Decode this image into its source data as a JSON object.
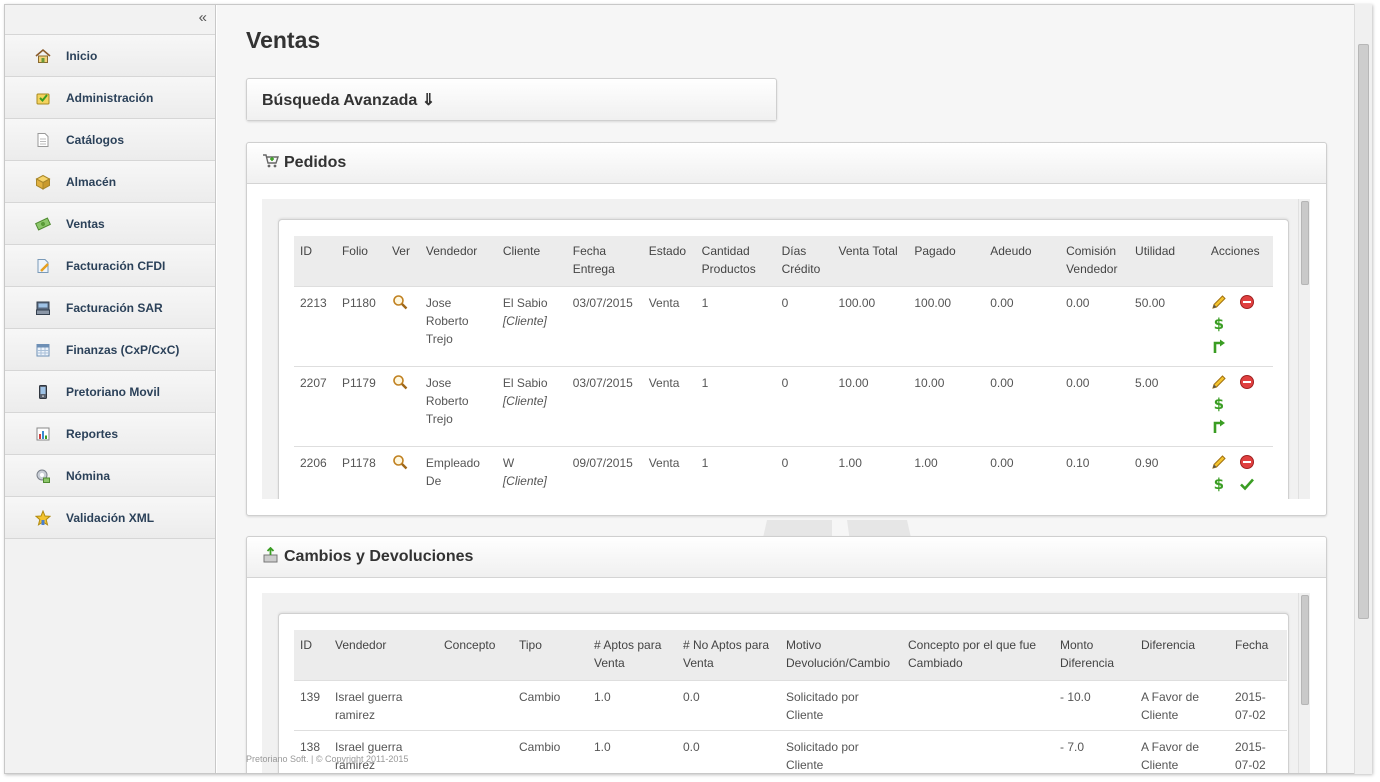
{
  "sidebar": {
    "collapse_label": "«",
    "items": [
      {
        "label": "Inicio",
        "icon": "home-icon"
      },
      {
        "label": "Administración",
        "icon": "admin-icon"
      },
      {
        "label": "Catálogos",
        "icon": "document-icon"
      },
      {
        "label": "Almacén",
        "icon": "box-icon"
      },
      {
        "label": "Ventas",
        "icon": "money-icon"
      },
      {
        "label": "Facturación CFDI",
        "icon": "invoice-icon"
      },
      {
        "label": "Facturación SAR",
        "icon": "register-icon"
      },
      {
        "label": "Finanzas (CxP/CxC)",
        "icon": "calendar-icon"
      },
      {
        "label": "Pretoriano Movil",
        "icon": "mobile-icon"
      },
      {
        "label": "Reportes",
        "icon": "report-icon"
      },
      {
        "label": "Nómina",
        "icon": "payroll-icon"
      },
      {
        "label": "Validación XML",
        "icon": "star-icon"
      }
    ]
  },
  "main": {
    "title": "Ventas",
    "busqueda_label": "Búsqueda Avanzada ⇓",
    "pedidos": {
      "title": "Pedidos",
      "columns": [
        "ID",
        "Folio",
        "Ver",
        "Vendedor",
        "Cliente",
        "Fecha Entrega",
        "Estado",
        "Cantidad Productos",
        "Días Crédito",
        "Venta Total",
        "Pagado",
        "Adeudo",
        "Comisión Vendedor",
        "Utilidad",
        "Acciones"
      ],
      "rows": [
        {
          "id": "2213",
          "folio": "P1180",
          "vendedor": "Jose Roberto Trejo",
          "cliente": "El Sabio",
          "cliente_tag": "[Cliente]",
          "fecha": "03/07/2015",
          "estado": "Venta",
          "cantidad": "1",
          "dias": "0",
          "total": "100.00",
          "pagado": "100.00",
          "adeudo": "0.00",
          "comision": "0.00",
          "utilidad": "50.00"
        },
        {
          "id": "2207",
          "folio": "P1179",
          "vendedor": "Jose Roberto Trejo",
          "cliente": "El Sabio",
          "cliente_tag": "[Cliente]",
          "fecha": "03/07/2015",
          "estado": "Venta",
          "cantidad": "1",
          "dias": "0",
          "total": "10.00",
          "pagado": "10.00",
          "adeudo": "0.00",
          "comision": "0.00",
          "utilidad": "5.00"
        },
        {
          "id": "2206",
          "folio": "P1178",
          "vendedor": "Empleado De",
          "cliente": "W",
          "cliente_tag": "[Cliente]",
          "fecha": "09/07/2015",
          "estado": "Venta",
          "cantidad": "1",
          "dias": "0",
          "total": "1.00",
          "pagado": "1.00",
          "adeudo": "0.00",
          "comision": "0.10",
          "utilidad": "0.90"
        }
      ]
    },
    "cambios": {
      "title": "Cambios y Devoluciones",
      "columns": [
        "ID",
        "Vendedor",
        "Concepto",
        "Tipo",
        "# Aptos para Venta",
        "# No Aptos para Venta",
        "Motivo Devolución/Cambio",
        "Concepto por el que fue Cambiado",
        "Monto Diferencia",
        "Diferencia",
        "Fecha"
      ],
      "rows": [
        {
          "id": "139",
          "vendedor": "Israel guerra ramirez",
          "concepto": "",
          "tipo": "Cambio",
          "aptos": "1.0",
          "no_aptos": "0.0",
          "motivo": "Solicitado por Cliente",
          "concepto_cambio": "",
          "monto": "- 10.0",
          "diferencia": "A Favor de Cliente",
          "fecha": "2015-07-02"
        },
        {
          "id": "138",
          "vendedor": "Israel guerra ramirez",
          "concepto": "",
          "tipo": "Cambio",
          "aptos": "1.0",
          "no_aptos": "0.0",
          "motivo": "Solicitado por Cliente",
          "concepto_cambio": "",
          "monto": "- 7.0",
          "diferencia": "A Favor de Cliente",
          "fecha": "2015-07-02"
        }
      ]
    },
    "footer": "Pretoriano Soft. | © Copyright 2011-2015"
  },
  "colors": {
    "nav_text": "#2b4159",
    "accent_green": "#3a9d23",
    "delete_red": "#e04040"
  }
}
